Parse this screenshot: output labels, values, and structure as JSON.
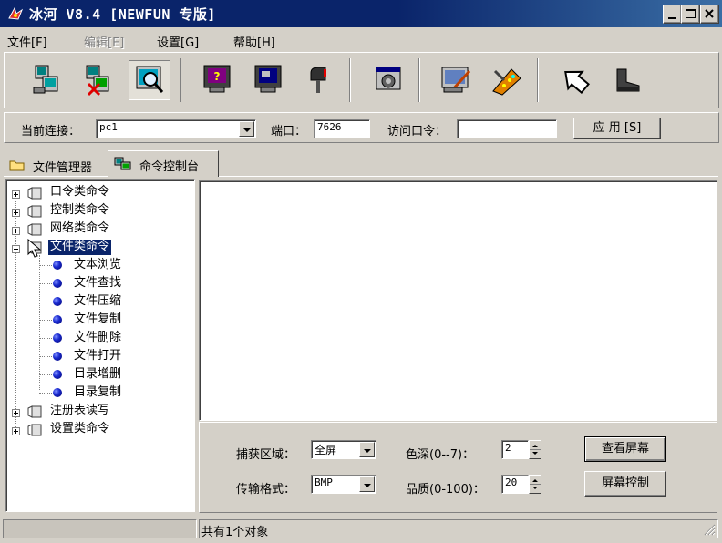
{
  "window": {
    "title": "冰河 V8.4 [NEWFUN 专版]",
    "minimize_glyph": "_",
    "accent": "#0a246a"
  },
  "menu": [
    {
      "label": "文件[F]",
      "enabled": true
    },
    {
      "label": "编辑[E]",
      "enabled": false
    },
    {
      "label": "设置[G]",
      "enabled": true
    },
    {
      "label": "帮助[H]",
      "enabled": true
    }
  ],
  "toolbar": {
    "buttons": [
      "add-host-icon",
      "delete-host-icon",
      "search-host-icon",
      "capture-screen-icon",
      "control-screen-icon",
      "mailbox-icon",
      "settings-icon",
      "server-config-icon",
      "tools-icon",
      "up-icon",
      "exit-boot-icon"
    ]
  },
  "connection": {
    "current_label": "当前连接：",
    "current_value": "pc1",
    "port_label": "端口：",
    "port_value": "7626",
    "password_label": "访问口令：",
    "password_value": "",
    "apply_label": "应 用 [S]"
  },
  "tabs": [
    {
      "label": "文件管理器",
      "active": false
    },
    {
      "label": "命令控制台",
      "active": true
    }
  ],
  "tree": {
    "groups_top": [
      "口令类命令",
      "控制类命令",
      "网络类命令"
    ],
    "expanded": {
      "label": "文件类命令",
      "children": [
        "文本浏览",
        "文件查找",
        "文件压缩",
        "文件复制",
        "文件删除",
        "文件打开",
        "目录增删",
        "目录复制"
      ]
    },
    "groups_bottom": [
      "注册表读写",
      "设置类命令"
    ]
  },
  "screen_panel": {
    "capture_area_label": "捕获区域：",
    "capture_area_value": "全屏",
    "format_label": "传输格式：",
    "format_value": "BMP",
    "depth_label": "色深(0--7)：",
    "depth_value": "2",
    "quality_label": "品质(0-100)：",
    "quality_value": "20",
    "view_screen_label": "查看屏幕",
    "screen_control_label": "屏幕控制"
  },
  "status": {
    "left": "",
    "right": "共有1个对象"
  }
}
